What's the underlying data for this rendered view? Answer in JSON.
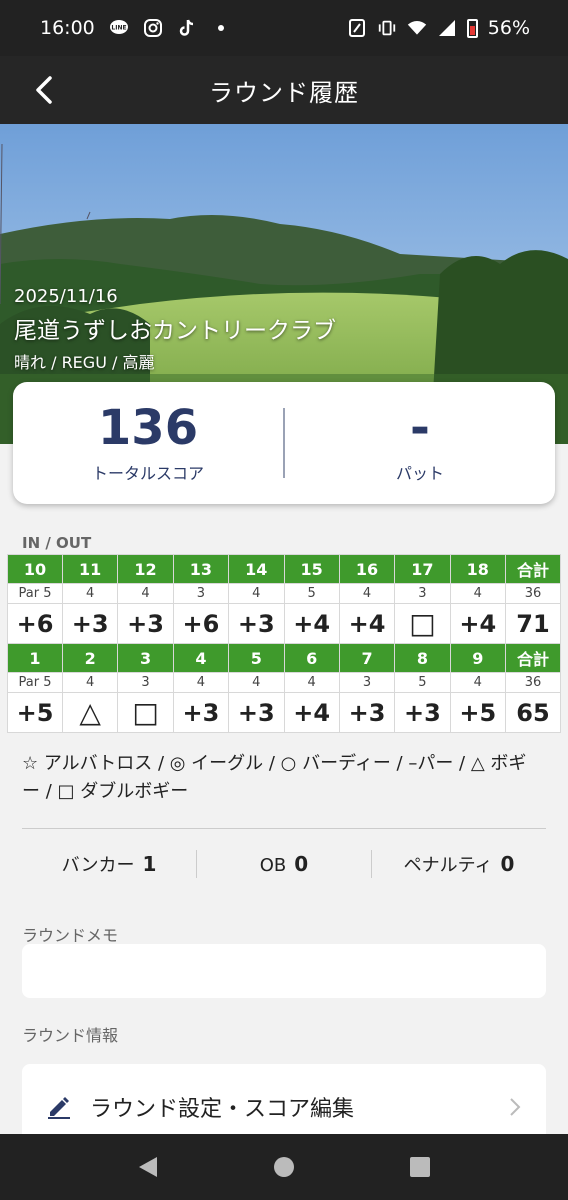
{
  "status_bar": {
    "time": "16:00",
    "battery": "56%",
    "icons": [
      "line-icon",
      "instagram-icon",
      "tiktok-icon",
      "dot-icon",
      "nfc-icon",
      "vibrate-icon",
      "wifi-icon",
      "signal-icon",
      "battery-icon"
    ]
  },
  "header": {
    "title": "ラウンド履歴"
  },
  "round": {
    "date": "2025/11/16",
    "course": "尾道うずしおカントリークラブ",
    "info": "晴れ / REGU / 高麗"
  },
  "summary": {
    "total_score": "136",
    "total_label": "トータルスコア",
    "putts": "-",
    "putts_label": "パット"
  },
  "scorecard": {
    "section_label": "IN / OUT",
    "in": {
      "holes": [
        "10",
        "11",
        "12",
        "13",
        "14",
        "15",
        "16",
        "17",
        "18",
        "合計"
      ],
      "pars": [
        "Par 5",
        "4",
        "4",
        "3",
        "4",
        "5",
        "4",
        "3",
        "4",
        "36"
      ],
      "scores": [
        "+6",
        "+3",
        "+3",
        "+6",
        "+3",
        "+4",
        "+4",
        "□",
        "+4",
        "71"
      ]
    },
    "out": {
      "holes": [
        "1",
        "2",
        "3",
        "4",
        "5",
        "6",
        "7",
        "8",
        "9",
        "合計"
      ],
      "pars": [
        "Par 5",
        "4",
        "3",
        "4",
        "4",
        "4",
        "3",
        "5",
        "4",
        "36"
      ],
      "scores": [
        "+5",
        "△",
        "□",
        "+3",
        "+3",
        "+4",
        "+3",
        "+3",
        "+5",
        "65"
      ]
    },
    "header_color": "#3f9a2c"
  },
  "legend": "☆ アルバトロス / ◎ イーグル / ○ バーディー / –パー / △ ボギー / □ ダブルボギー",
  "stats": {
    "bunker_label": "バンカー",
    "bunker_value": "1",
    "ob_label": "OB",
    "ob_value": "0",
    "penalty_label": "ペナルティ",
    "penalty_value": "0"
  },
  "memo": {
    "label": "ラウンドメモ",
    "value": ""
  },
  "round_info": {
    "label": "ラウンド情報",
    "settings_label": "ラウンド設定・スコア編集"
  },
  "colors": {
    "accent": "#2b3a67",
    "green": "#3f9a2c",
    "bar": "#222222"
  }
}
